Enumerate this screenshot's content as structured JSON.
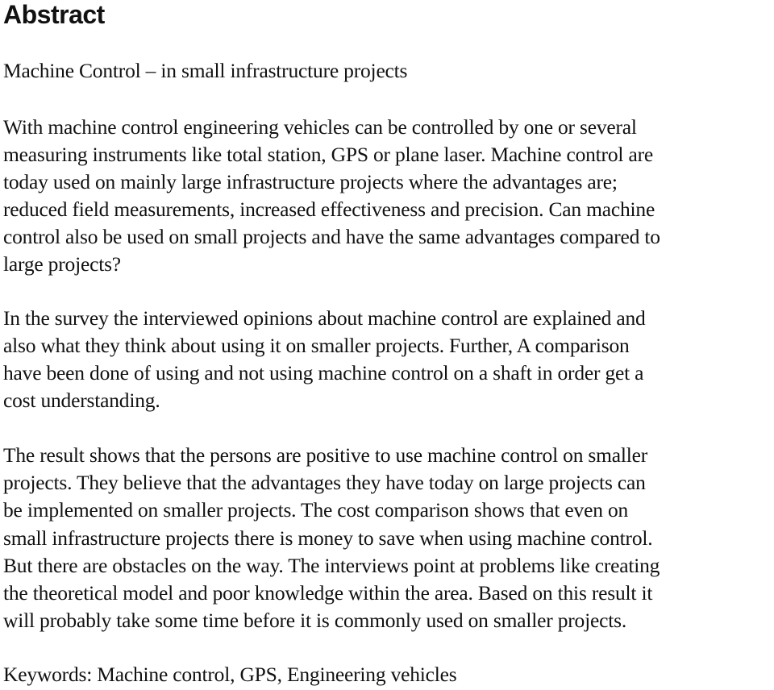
{
  "heading": "Abstract",
  "title": "Machine Control – in small infrastructure projects",
  "paragraphs": [
    {
      "lines": [
        "With machine control engineering vehicles can be controlled by one or several",
        "measuring instruments like total station, GPS or plane laser. Machine control are",
        "today used on mainly large infrastructure projects where the advantages are;",
        "reduced field measurements, increased effectiveness and precision. Can machine",
        "control also be used on small projects and have the same advantages compared to",
        "large projects?"
      ]
    },
    {
      "lines": [
        "In the survey the interviewed opinions about machine control are explained and",
        "also what they think about using it on smaller projects. Further, A comparison",
        "have been done of using and not using machine control on a shaft in order get a",
        "cost understanding."
      ]
    },
    {
      "lines": [
        "The result shows that the persons are positive to use machine control on smaller",
        "projects. They believe that the advantages they have today on large projects can",
        "be implemented on smaller projects. The cost comparison shows that even on",
        "small infrastructure projects there is money to save when using machine control.",
        "But there are obstacles on the way. The interviews point at problems like creating",
        "the theoretical model and poor knowledge within the area. Based on this result it",
        "will probably take some time before it is commonly used on smaller projects."
      ]
    }
  ],
  "keywords": "Keywords: Machine control, GPS, Engineering vehicles"
}
